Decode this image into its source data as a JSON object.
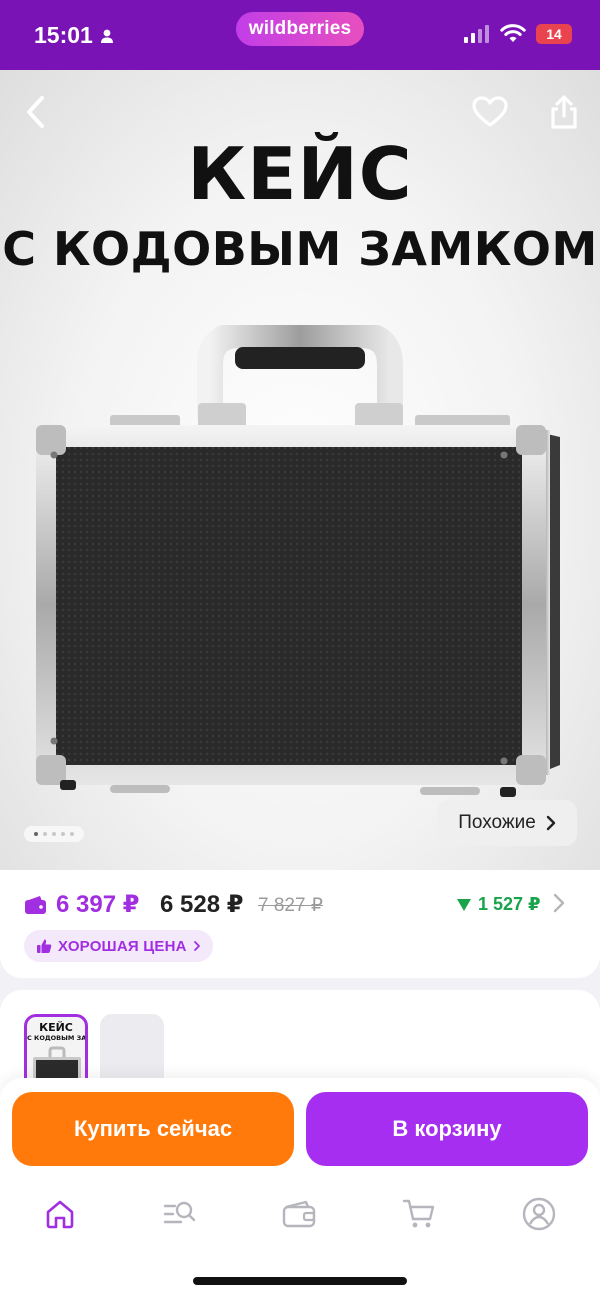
{
  "status_bar": {
    "time": "15:01",
    "brand": "wildberries",
    "battery": "14",
    "bg_color": "#7a13b5"
  },
  "hero": {
    "title_line1": "КЕЙС",
    "title_line2": "С КОДОВЫМ ЗАМКОМ",
    "similar_label": "Похожие",
    "image_count": 5,
    "active_image": 1,
    "icons": [
      "back-icon",
      "heart-icon",
      "share-icon"
    ]
  },
  "price": {
    "wallet_price": "6 397 ₽",
    "regular_price": "6 528 ₽",
    "old_price": "7 827 ₽",
    "discount": "1 527 ₽",
    "badge": "ХОРОШАЯ ЦЕНА",
    "accent_color": "#a12ee0",
    "discount_color": "#19a34b"
  },
  "gallery": {
    "thumb_text_line1": "КЕЙС",
    "thumb_text_line2": "С КОДОВЫМ ЗАМКОМ"
  },
  "actions": {
    "buy_now": "Купить сейчас",
    "add_to_cart": "В корзину",
    "buy_color": "#ff7a0a",
    "cart_color": "#a52ef0"
  },
  "tabbar": {
    "items": [
      "home-icon",
      "catalog-search-icon",
      "wallet-icon",
      "cart-icon",
      "profile-icon"
    ],
    "active": "home-icon"
  }
}
